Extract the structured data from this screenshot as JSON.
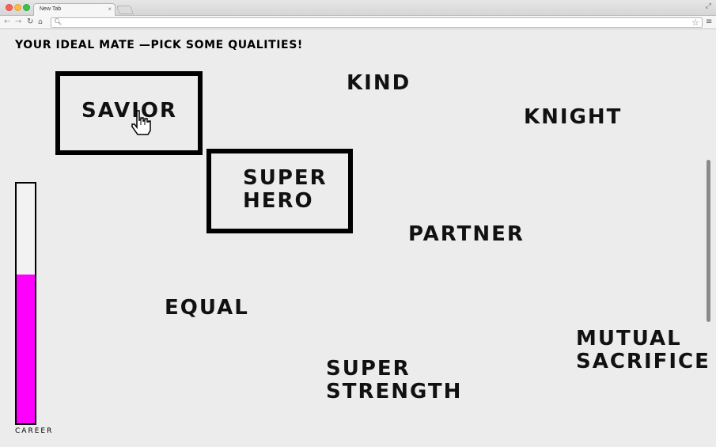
{
  "browser": {
    "tab_title": "New Tab",
    "tab_close": "×",
    "address": "",
    "icons": [
      "back-icon",
      "forward-icon",
      "reload-icon",
      "home-icon",
      "search-icon",
      "star-icon",
      "menu-icon",
      "fullscreen-icon"
    ]
  },
  "page": {
    "heading": "YOUR IDEAL MATE —PICK SOME QUALITIES!",
    "qualities": {
      "savior": {
        "label": "SAVIOR",
        "selected": true
      },
      "superhero": {
        "label": "SUPER\nHERO",
        "selected": true
      },
      "kind": {
        "label": "KIND",
        "selected": false
      },
      "knight": {
        "label": "KNIGHT",
        "selected": false
      },
      "partner": {
        "label": "PARTNER",
        "selected": false
      },
      "equal": {
        "label": "EQUAL",
        "selected": false
      },
      "superstrength": {
        "label": "SUPER\nSTRENGTH",
        "selected": false
      },
      "mutual": {
        "label": "MUTUAL\nSACRIFICE",
        "selected": false
      }
    },
    "meter": {
      "label": "CAREER",
      "level": 0.62,
      "color": "#ff00ff"
    }
  }
}
